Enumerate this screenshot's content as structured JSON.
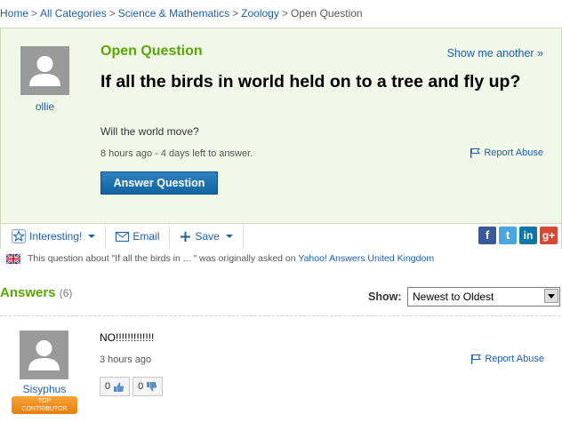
{
  "breadcrumb": {
    "items": [
      "Home",
      "All Categories",
      "Science & Mathematics",
      "Zoology"
    ],
    "current": "Open Question",
    "separator": ">"
  },
  "question": {
    "status": "Open Question",
    "show_another": "Show me another »",
    "asker_name": "ollie",
    "title": "If all the birds in world held on to a tree and fly up?",
    "detail": "Will the world move?",
    "meta": "8 hours ago - 4 days left to answer.",
    "report_label": "Report Abuse",
    "answer_button": "Answer Question"
  },
  "toolbar": {
    "interesting": "Interesting!",
    "email": "Email",
    "save": "Save",
    "social": [
      "f",
      "t",
      "in",
      "g+"
    ]
  },
  "origin_note": {
    "prefix": "This question about \"If all the birds in ... \" was originally asked on ",
    "link": "Yahoo! Answers United Kingdom"
  },
  "answers": {
    "heading": "Answers",
    "count": "(6)",
    "show_label": "Show:",
    "sort_selected": "Newest to Oldest",
    "items": [
      {
        "author": "Sisyphus",
        "badge_line1": "TOP",
        "badge_line2": "CONTRIBUTOR",
        "text": "NO!!!!!!!!!!!!!",
        "time": "3 hours ago",
        "report_label": "Report Abuse",
        "thumbs_up": "0",
        "thumbs_down": "0"
      }
    ]
  },
  "colors": {
    "accent_green": "#5aa600",
    "link_blue": "#1d5fa6",
    "question_bg": "#f1f7e9",
    "button_blue": "#1363a1",
    "badge_orange": "#f39a2c"
  }
}
